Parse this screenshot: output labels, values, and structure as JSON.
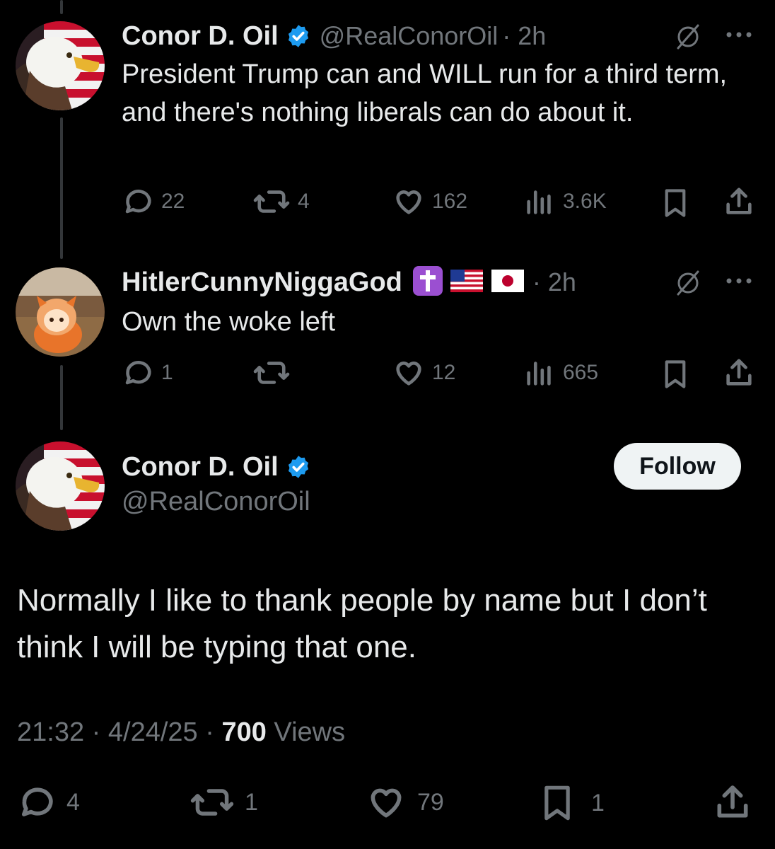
{
  "tweet1": {
    "display_name": "Conor D. Oil",
    "handle": "@RealConorOil",
    "time": "· 2h",
    "text": "President Trump can and WILL run for a third term, and there's nothing liberals can do about it.",
    "replies": "22",
    "reposts": "4",
    "likes": "162",
    "views": "3.6K"
  },
  "tweet2": {
    "display_name": "HitlerCunnyNiggaGod",
    "time": "· 2h",
    "text": "Own the woke left",
    "replies": "1",
    "reposts": "",
    "likes": "12",
    "views": "665"
  },
  "main_tweet": {
    "display_name": "Conor D. Oil",
    "handle": "@RealConorOil",
    "follow_label": "Follow",
    "text": "Normally I like to thank people by name but I don’t think I will be typing that one.",
    "time": "21:32",
    "date": "4/24/25",
    "views_count": "700",
    "views_label": "Views",
    "replies": "4",
    "reposts": "1",
    "likes": "79",
    "bookmarks": "1"
  },
  "icons": {
    "verified": "verified-badge-icon",
    "grok": "grok-icon",
    "more": "more-icon",
    "reply": "reply-icon",
    "repost": "repost-icon",
    "like": "like-icon",
    "views": "views-icon",
    "bookmark": "bookmark-icon",
    "share": "share-icon"
  },
  "colors": {
    "background": "#000000",
    "text": "#e7e9ea",
    "muted": "#71767b",
    "verified": "#1d9bf0",
    "follow_bg": "#eff3f4"
  }
}
